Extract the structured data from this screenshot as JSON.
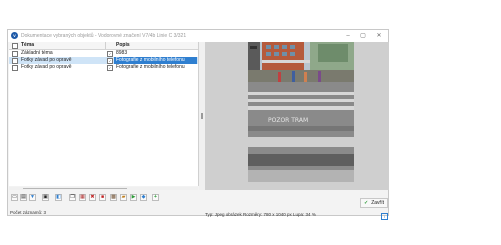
{
  "window": {
    "title": "Dokumentace vybraných objektů - Vodorovné značení V7/4b Linie C 3/321",
    "icon_name": "app-logo-icon",
    "controls": {
      "minimize": "–",
      "maximize": "▢",
      "close": "✕"
    }
  },
  "table": {
    "columns": [
      "Téma",
      "Popis"
    ],
    "rows": [
      {
        "theme": "Základní téma",
        "desc_icon": "✓",
        "desc": "8983",
        "selected": false
      },
      {
        "theme": "Fotky závad po opravě",
        "desc_icon": "✓",
        "desc": "Fotografie z mobilního telefonu",
        "selected": true
      },
      {
        "theme": "Fotky závad po opravě",
        "desc_icon": "✓",
        "desc": "Fotografie z mobilního telefonu",
        "selected": false
      }
    ]
  },
  "preview": {
    "road_text": "POZOR TRAM",
    "status": "Typ: Jpeg obrázek  Rozměry: 780 x 1040 px  Lupa: 34 %",
    "info_icon": "i"
  },
  "toolbar": {
    "icons": [
      "select-icon",
      "add-icon",
      "filter-icon",
      "view-icon",
      "camera-icon",
      "copy-icon",
      "document-icon",
      "delete-icon",
      "pdf-icon",
      "photo-icon",
      "folder-icon",
      "play-icon",
      "export-icon",
      "plus-icon"
    ]
  },
  "footer": {
    "close_label": "Zavřít",
    "close_icon": "✓",
    "record_count": "Počet záznamů: 3"
  },
  "colors": {
    "selection": "#2f7fd0",
    "row_highlight": "#cfe4f7",
    "accent_green": "#2e9b3a"
  }
}
